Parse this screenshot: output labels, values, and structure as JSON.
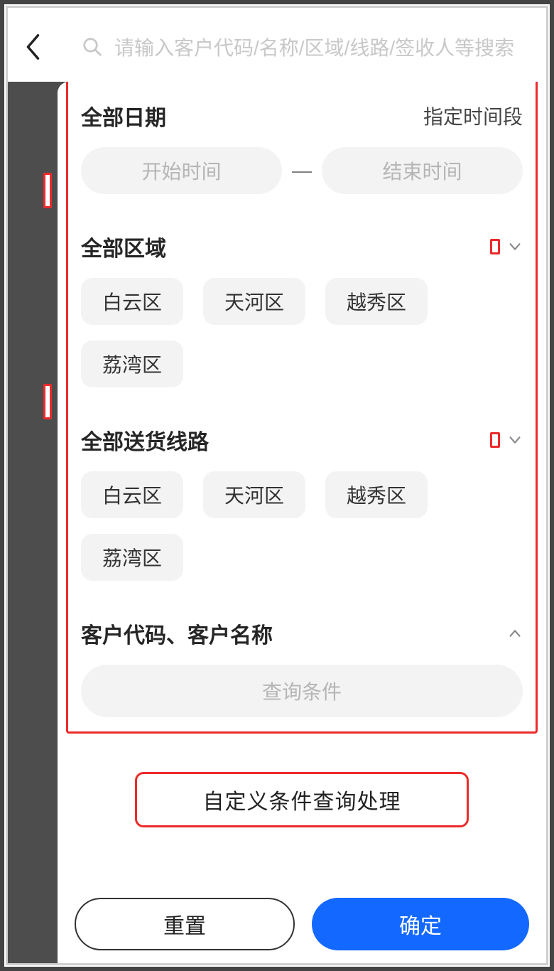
{
  "search": {
    "placeholder": "请输入客户代码/名称/区域/线路/签收人等搜索"
  },
  "date": {
    "title": "全部日期",
    "action": "指定时间段",
    "start": "开始时间",
    "end": "结束时间"
  },
  "region": {
    "title": "全部区域",
    "options": [
      "白云区",
      "天河区",
      "越秀区",
      "荔湾区"
    ]
  },
  "route": {
    "title": "全部送货线路",
    "options": [
      "白云区",
      "天河区",
      "越秀区",
      "荔湾区"
    ]
  },
  "customer": {
    "title": "客户代码、客户名称",
    "placeholder": "查询条件"
  },
  "callout": "自定义条件查询处理",
  "footer": {
    "reset": "重置",
    "confirm": "确定"
  }
}
